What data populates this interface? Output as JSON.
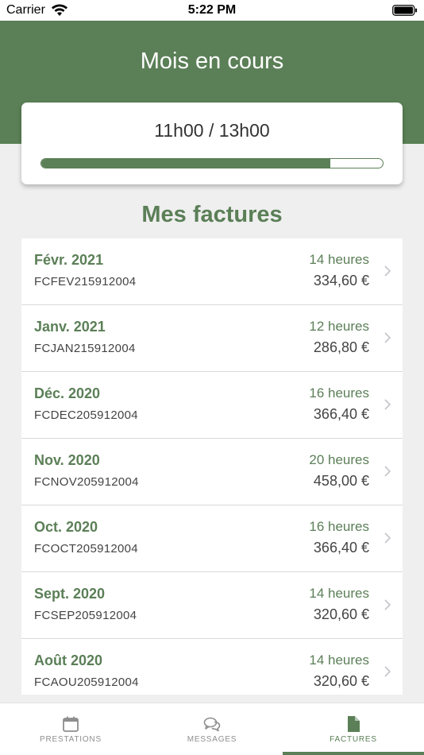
{
  "status_bar": {
    "carrier": "Carrier",
    "time": "5:22 PM"
  },
  "header": {
    "title": "Mois en cours"
  },
  "progress": {
    "text": "11h00 / 13h00",
    "fraction": 0.846
  },
  "section_title": "Mes factures",
  "invoices": [
    {
      "month": "Févr. 2021",
      "number": "FCFEV215912004",
      "hours": "14 heures",
      "amount": "334,60 €"
    },
    {
      "month": "Janv. 2021",
      "number": "FCJAN215912004",
      "hours": "12 heures",
      "amount": "286,80 €"
    },
    {
      "month": "Déc. 2020",
      "number": "FCDEC205912004",
      "hours": "16 heures",
      "amount": "366,40 €"
    },
    {
      "month": "Nov. 2020",
      "number": "FCNOV205912004",
      "hours": "20 heures",
      "amount": "458,00 €"
    },
    {
      "month": "Oct. 2020",
      "number": "FCOCT205912004",
      "hours": "16 heures",
      "amount": "366,40 €"
    },
    {
      "month": "Sept. 2020",
      "number": "FCSEP205912004",
      "hours": "14 heures",
      "amount": "320,60 €"
    },
    {
      "month": "Août 2020",
      "number": "FCAOU205912004",
      "hours": "14 heures",
      "amount": "320,60 €"
    }
  ],
  "tab_bar": {
    "tabs": [
      {
        "label": "PRESTATIONS",
        "icon": "calendar-icon"
      },
      {
        "label": "MESSAGES",
        "icon": "chat-icon"
      },
      {
        "label": "FACTURES",
        "icon": "document-icon"
      }
    ],
    "active_index": 2
  },
  "colors": {
    "brand_green": "#5b7f57",
    "background": "#efefef",
    "tab_inactive": "#8e8e8e"
  }
}
